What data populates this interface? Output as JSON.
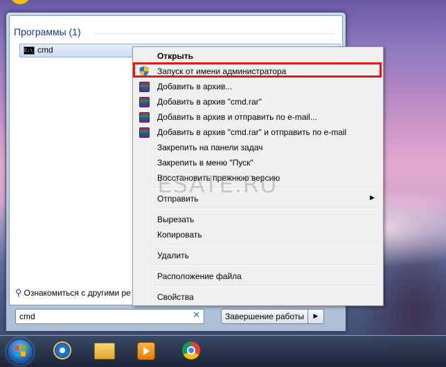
{
  "start_menu": {
    "section_header": "Программы (1)",
    "result": {
      "label": "cmd",
      "icon": "command-prompt-icon"
    },
    "see_more_label": "Ознакомиться с другими ре",
    "search": {
      "value": "cmd",
      "placeholder": "",
      "clear_glyph": "✕"
    },
    "shutdown_label": "Завершение работы",
    "shutdown_arrow": "▶"
  },
  "context_menu": {
    "open": "Открыть",
    "run_as_admin": "Запуск от имени администратора",
    "add_to_archive": "Добавить в архив...",
    "add_to_cmd_rar": "Добавить в архив \"cmd.rar\"",
    "add_and_email": "Добавить в архив и отправить по e-mail...",
    "add_cmd_rar_email": "Добавить в архив \"cmd.rar\" и отправить по e-mail",
    "pin_taskbar": "Закрепить на панели задач",
    "pin_start": "Закрепить в меню \"Пуск\"",
    "restore_previous": "Восстановить прежнюю версию",
    "send_to": "Отправить",
    "submenu_glyph": "▶",
    "cut": "Вырезать",
    "copy": "Копировать",
    "delete": "Удалить",
    "file_location": "Расположение файла",
    "properties": "Свойства",
    "highlight_color": "#e01a1a"
  },
  "watermark": "ESATE.RU",
  "taskbar": {
    "items": [
      "start-orb",
      "internet-explorer-icon",
      "windows-explorer-icon",
      "media-player-icon",
      "chrome-icon"
    ]
  }
}
